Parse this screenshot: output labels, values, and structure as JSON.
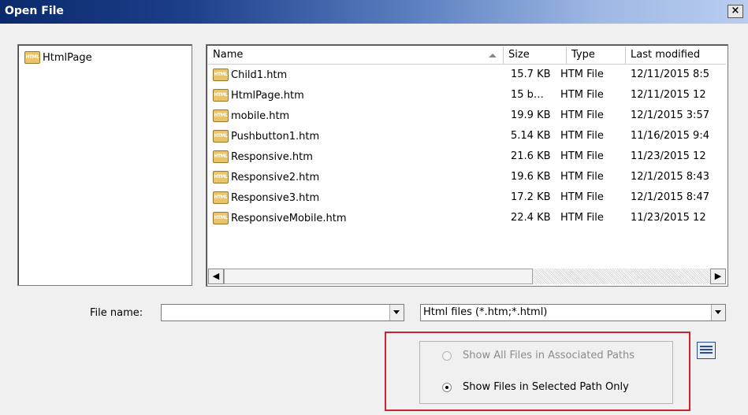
{
  "window": {
    "title": "Open File",
    "close_label": "×"
  },
  "directories": [
    {
      "label": "HtmlPage",
      "icon": "html-file-icon"
    }
  ],
  "icon_text": "HTML",
  "file_list": {
    "columns": {
      "name": "Name",
      "size": "Size",
      "type": "Type",
      "modified": "Last modified"
    },
    "sort_column": "Name",
    "rows": [
      {
        "name": "Child1.htm",
        "size": "15.7 KB",
        "type": "HTM File",
        "modified": "12/11/2015 8:5"
      },
      {
        "name": "HtmlPage.htm",
        "size": "15 b…",
        "type": "HTM File",
        "modified": "12/11/2015 12"
      },
      {
        "name": "mobile.htm",
        "size": "19.9 KB",
        "type": "HTM File",
        "modified": "12/1/2015 3:57"
      },
      {
        "name": "Pushbutton1.htm",
        "size": "5.14 KB",
        "type": "HTM File",
        "modified": "11/16/2015 9:4"
      },
      {
        "name": "Responsive.htm",
        "size": "21.6 KB",
        "type": "HTM File",
        "modified": "11/23/2015 12"
      },
      {
        "name": "Responsive2.htm",
        "size": "19.6 KB",
        "type": "HTM File",
        "modified": "12/1/2015 8:43"
      },
      {
        "name": "Responsive3.htm",
        "size": "17.2 KB",
        "type": "HTM File",
        "modified": "12/1/2015 8:47"
      },
      {
        "name": "ResponsiveMobile.htm",
        "size": "22.4 KB",
        "type": "HTM File",
        "modified": "11/23/2015 12"
      }
    ]
  },
  "scrollbar": {
    "left_arrow": "◀",
    "right_arrow": "▶"
  },
  "file_name": {
    "label": "File name:",
    "value": ""
  },
  "file_type": {
    "value": "Html files (*.htm;*.html)"
  },
  "options": {
    "show_all": {
      "label": "Show All Files in Associated Paths",
      "checked": false,
      "enabled": false
    },
    "show_selected": {
      "label": "Show Files in Selected Path Only",
      "checked": true,
      "enabled": true
    }
  }
}
